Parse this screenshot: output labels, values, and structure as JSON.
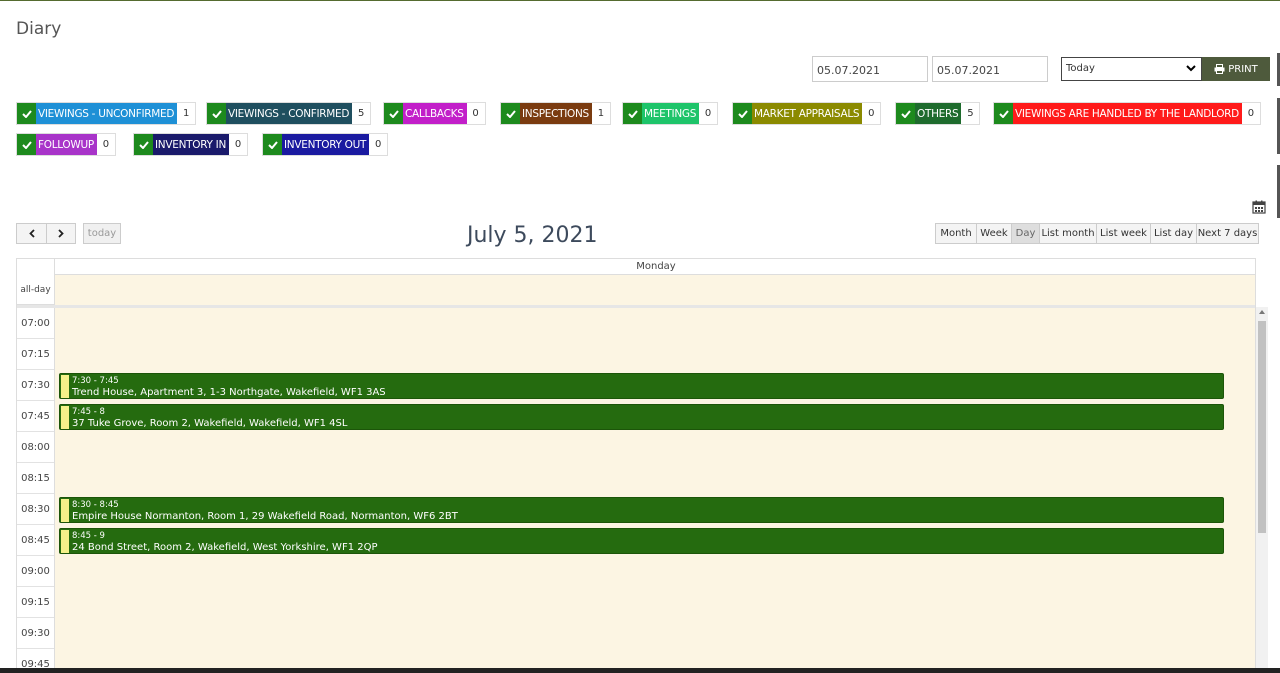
{
  "page": {
    "title": "Diary"
  },
  "filters": {
    "date_from": "05.07.2021",
    "date_to": "05.07.2021",
    "range_select": "Today",
    "print_label": "PRINT"
  },
  "categories": [
    {
      "label": "VIEWINGS - UNCONFIRMED",
      "count": "1",
      "color": "#1e90d6"
    },
    {
      "label": "VIEWINGS - CONFIRMED",
      "count": "5",
      "color": "#1f4f5f"
    },
    {
      "label": "CALLBACKS",
      "count": "0",
      "color": "#c21fc9"
    },
    {
      "label": "INSPECTIONS",
      "count": "1",
      "color": "#7a3b10"
    },
    {
      "label": "MEETINGS",
      "count": "0",
      "color": "#1ec46a"
    },
    {
      "label": "MARKET APPRAISALS",
      "count": "0",
      "color": "#8b8a00"
    },
    {
      "label": "OTHERS",
      "count": "5",
      "color": "#1e6b2d"
    },
    {
      "label": "VIEWINGS ARE HANDLED BY THE LANDLORD",
      "count": "0",
      "color": "#ff1a1a"
    },
    {
      "label": "FOLLOWUP",
      "count": "0",
      "color": "#a834c9"
    },
    {
      "label": "INVENTORY IN",
      "count": "0",
      "color": "#1a1a6b"
    },
    {
      "label": "INVENTORY OUT",
      "count": "0",
      "color": "#1a1aa0"
    }
  ],
  "calendar": {
    "prev_label": "<",
    "next_label": ">",
    "today_label": "today",
    "title": "July 5, 2021",
    "views": [
      "Month",
      "Week",
      "Day",
      "List month",
      "List week",
      "List day",
      "Next 7 days"
    ],
    "active_view": "Day",
    "day_header": "Monday",
    "allday_label": "all-day",
    "time_slots": [
      "07:00",
      "07:15",
      "07:30",
      "07:45",
      "08:00",
      "08:15",
      "08:30",
      "08:45",
      "09:00",
      "09:15",
      "09:30",
      "09:45"
    ],
    "events": [
      {
        "time": "7:30 - 7:45",
        "where": "Trend House, Apartment 3, 1-3 Northgate, Wakefield, WF1 3AS",
        "slot": "07:30"
      },
      {
        "time": "7:45 - 8",
        "where": "37 Tuke Grove, Room 2, Wakefield, Wakefield, WF1 4SL",
        "slot": "07:45"
      },
      {
        "time": "8:30 - 8:45",
        "where": "Empire House Normanton, Room 1, 29 Wakefield Road, Normanton, WF6 2BT",
        "slot": "08:30"
      },
      {
        "time": "8:45 - 9",
        "where": "24 Bond Street, Room 2, Wakefield, West Yorkshire, WF1 2QP",
        "slot": "08:45"
      }
    ]
  }
}
